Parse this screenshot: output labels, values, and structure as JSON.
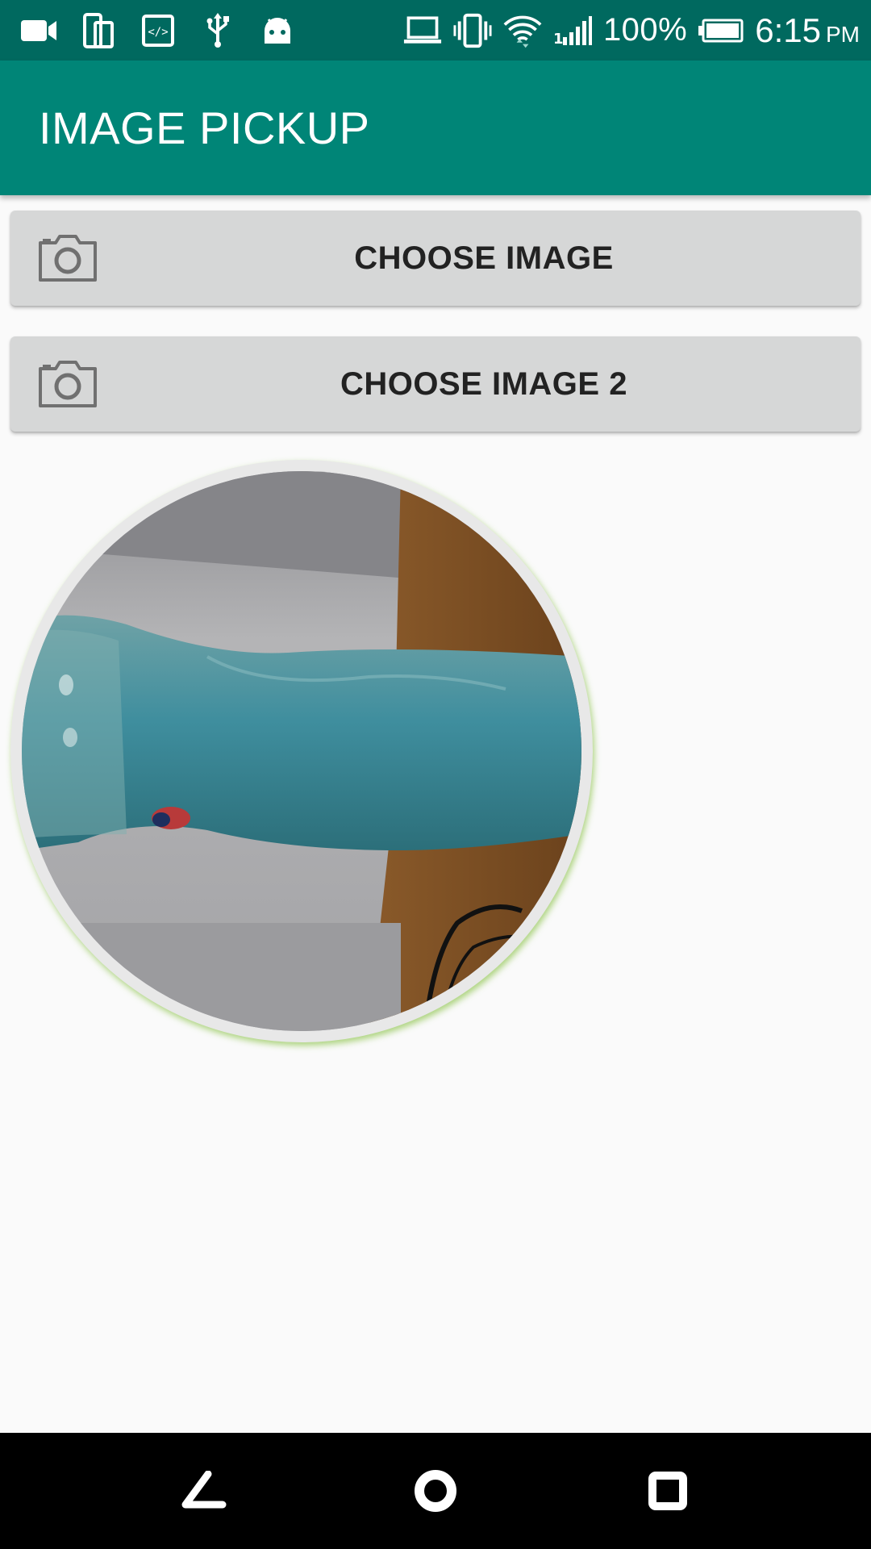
{
  "status_bar": {
    "battery_percent": "100%",
    "time": "6:15",
    "ampm": "PM",
    "left_icons": [
      "video-camera-icon",
      "device-rotate-icon",
      "code-icon",
      "usb-icon",
      "android-icon"
    ],
    "right_icons": [
      "laptop-icon",
      "vibrate-icon",
      "wifi-icon",
      "signal-icon",
      "battery-icon"
    ],
    "color": "#00695f"
  },
  "app_bar": {
    "title": "IMAGE PICKUP",
    "color": "#008577"
  },
  "buttons": [
    {
      "label": "CHOOSE IMAGE",
      "icon": "camera-icon"
    },
    {
      "label": "CHOOSE IMAGE 2",
      "icon": "camera-icon"
    }
  ],
  "image_view": {
    "shape": "circle",
    "border_color": "#e8e8e8",
    "shadow_color": "#8bc34a"
  },
  "nav_bar": {
    "buttons": [
      "back-icon",
      "home-icon",
      "recent-apps-icon"
    ]
  }
}
